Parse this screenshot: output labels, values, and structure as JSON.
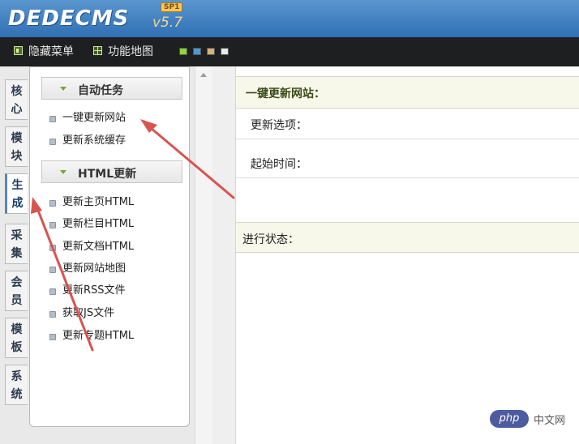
{
  "header": {
    "logo_text": "DEDECMS",
    "logo_version": "v5.7",
    "logo_sp": "SP1"
  },
  "toolbar": {
    "hide_menu_label": "隐藏菜单",
    "sitemap_label": "功能地图",
    "theme_swatches": [
      "#8fd43a",
      "#4a9ad8",
      "#d8b07a",
      "#e8e8e8"
    ]
  },
  "side_tabs": [
    {
      "label": "核心",
      "active": false
    },
    {
      "label": "模块",
      "active": false
    },
    {
      "label": "生成",
      "active": true
    },
    {
      "label": "采集",
      "active": false
    },
    {
      "label": "会员",
      "active": false
    },
    {
      "label": "模板",
      "active": false
    },
    {
      "label": "系统",
      "active": false
    }
  ],
  "menu": {
    "sections": [
      {
        "title": "自动任务",
        "items": [
          "一键更新网站",
          "更新系统缓存"
        ]
      },
      {
        "title": "HTML更新",
        "items": [
          "更新主页HTML",
          "更新栏目HTML",
          "更新文档HTML",
          "更新网站地图",
          "更新RSS文件",
          "获取JS文件",
          "更新专题HTML"
        ]
      }
    ]
  },
  "main": {
    "title": "一键更新网站：",
    "rows": [
      "更新选项：",
      "起始时间："
    ],
    "status_label": "进行状态："
  },
  "annotations": {
    "arrow_color": "#d9534f"
  },
  "watermark": {
    "badge": "php",
    "text": "中文网"
  }
}
